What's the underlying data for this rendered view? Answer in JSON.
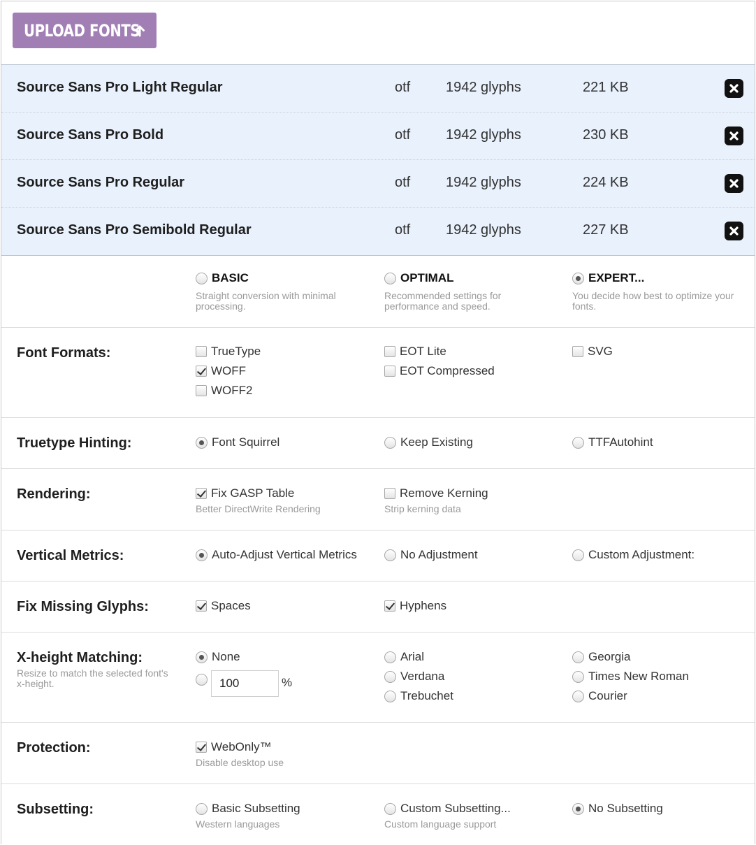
{
  "upload": {
    "label": "UPLOAD FONTS"
  },
  "fonts": [
    {
      "name": "Source Sans Pro Light Regular",
      "type": "otf",
      "glyphs": "1942 glyphs",
      "size": "221 KB"
    },
    {
      "name": "Source Sans Pro Bold",
      "type": "otf",
      "glyphs": "1942 glyphs",
      "size": "230 KB"
    },
    {
      "name": "Source Sans Pro Regular",
      "type": "otf",
      "glyphs": "1942 glyphs",
      "size": "224 KB"
    },
    {
      "name": "Source Sans Pro Semibold Regular",
      "type": "otf",
      "glyphs": "1942 glyphs",
      "size": "227 KB"
    }
  ],
  "mode": {
    "basic": {
      "label": "BASIC",
      "desc": "Straight conversion with minimal processing."
    },
    "optimal": {
      "label": "OPTIMAL",
      "desc": "Recommended settings for performance and speed."
    },
    "expert": {
      "label": "EXPERT...",
      "desc": "You decide how best to optimize your fonts."
    }
  },
  "formats": {
    "label": "Font Formats:",
    "truetype": "TrueType",
    "woff": "WOFF",
    "woff2": "WOFF2",
    "eot_lite": "EOT Lite",
    "eot_compressed": "EOT Compressed",
    "svg": "SVG"
  },
  "hinting": {
    "label": "Truetype Hinting:",
    "font_squirrel": "Font Squirrel",
    "keep_existing": "Keep Existing",
    "ttfautohint": "TTFAutohint"
  },
  "rendering": {
    "label": "Rendering:",
    "fix_gasp": "Fix GASP Table",
    "fix_gasp_desc": "Better DirectWrite Rendering",
    "remove_kerning": "Remove Kerning",
    "remove_kerning_desc": "Strip kerning data"
  },
  "vertical": {
    "label": "Vertical Metrics:",
    "auto": "Auto-Adjust Vertical Metrics",
    "none": "No Adjustment",
    "custom": "Custom Adjustment:"
  },
  "missing": {
    "label": "Fix Missing Glyphs:",
    "spaces": "Spaces",
    "hyphens": "Hyphens"
  },
  "xheight": {
    "label": "X-height Matching:",
    "desc": "Resize to match the selected font's x-height.",
    "none": "None",
    "value": "100",
    "percent": "%",
    "arial": "Arial",
    "verdana": "Verdana",
    "trebuchet": "Trebuchet",
    "georgia": "Georgia",
    "times": "Times New Roman",
    "courier": "Courier"
  },
  "protection": {
    "label": "Protection:",
    "webonly": "WebOnly™",
    "webonly_desc": "Disable desktop use"
  },
  "subsetting": {
    "label": "Subsetting:",
    "basic": "Basic Subsetting",
    "basic_desc": "Western languages",
    "custom": "Custom Subsetting...",
    "custom_desc": "Custom language support",
    "none": "No Subsetting"
  },
  "colors": {
    "accent": "#a17fb5",
    "row_bg": "#e9f1fc"
  }
}
